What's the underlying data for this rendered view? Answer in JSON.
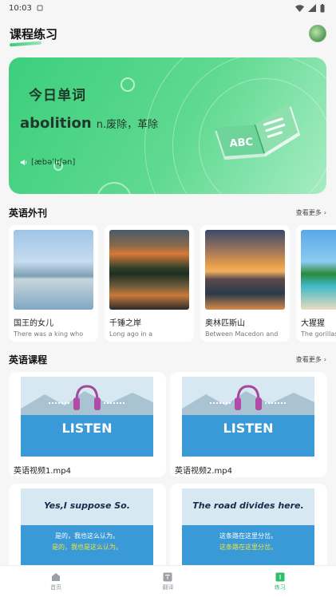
{
  "status": {
    "time": "10:03"
  },
  "header": {
    "title": "课程练习"
  },
  "word_card": {
    "title": "今日单词",
    "word": "abolition",
    "definition": "n.废除，革除",
    "phonetic": "[æbəˈlɪʃən]",
    "book_text": "ABC"
  },
  "magazines": {
    "section_title": "英语外刊",
    "see_more": "查看更多",
    "items": [
      {
        "title": "国王的女儿",
        "subtitle": "There was a king who"
      },
      {
        "title": "千锤之岸",
        "subtitle": "Long ago in a"
      },
      {
        "title": "奥林匹斯山",
        "subtitle": "Between Macedon and"
      },
      {
        "title": "大猩猩",
        "subtitle": "The gorillas in"
      }
    ]
  },
  "courses": {
    "section_title": "英语课程",
    "see_more": "查看更多",
    "items": [
      {
        "label": "英语视频1.mp4",
        "thumb_text": "LISTEN"
      },
      {
        "label": "英语视频2.mp4",
        "thumb_text": "LISTEN"
      },
      {
        "label": "",
        "thumb_title": "Yes,I suppose So.",
        "thumb_line1": "是的，我也这么认为。",
        "thumb_line2": "是的，我也是这么认为。"
      },
      {
        "label": "",
        "thumb_title": "The road divides here.",
        "thumb_line1": "这条路在这里分岔。",
        "thumb_line2": "这条路在这里分岔。"
      }
    ]
  },
  "nav": {
    "items": [
      {
        "label": "首页",
        "icon": "home-icon"
      },
      {
        "label": "翻译",
        "icon": "translate-icon"
      },
      {
        "label": "练习",
        "icon": "practice-icon"
      }
    ],
    "active": "练习"
  },
  "colors": {
    "accent": "#2fbf6a",
    "hero_start": "#3ccf7b",
    "hero_end": "#a6ecc2"
  }
}
